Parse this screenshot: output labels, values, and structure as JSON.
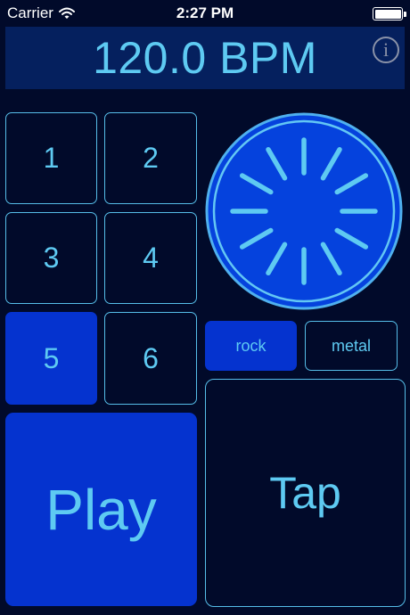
{
  "status_bar": {
    "carrier": "Carrier",
    "time": "2:27 PM",
    "icons": [
      "wifi-icon",
      "battery-icon"
    ]
  },
  "header": {
    "bpm": "120.0 BPM",
    "info_glyph": "i"
  },
  "beat_buttons": [
    {
      "label": "1",
      "selected": false
    },
    {
      "label": "2",
      "selected": false
    },
    {
      "label": "3",
      "selected": false
    },
    {
      "label": "4",
      "selected": false
    },
    {
      "label": "5",
      "selected": true
    },
    {
      "label": "6",
      "selected": false
    }
  ],
  "genres": [
    {
      "label": "rock",
      "selected": true
    },
    {
      "label": "metal",
      "selected": false
    }
  ],
  "controls": {
    "play_label": "Play",
    "tap_label": "Tap"
  },
  "dial": {
    "tick_count": 12
  },
  "colors": {
    "background": "#010a2a",
    "header_bg": "#05205e",
    "accent": "#0533cf",
    "text": "#5ecaf2",
    "border": "#56bde8",
    "dial_fill": "#0542dd",
    "dial_ring": "#4fb0ee"
  }
}
